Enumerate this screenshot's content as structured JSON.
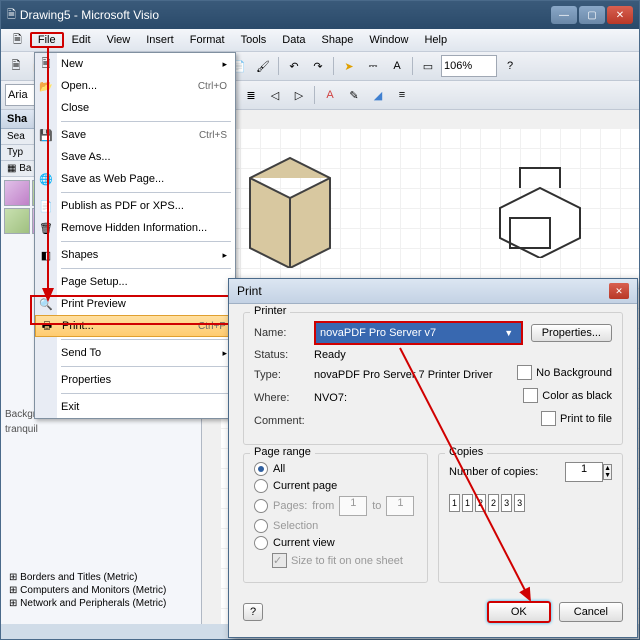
{
  "app": {
    "title": "Drawing5 - Microsoft Visio"
  },
  "menu": {
    "file": "File",
    "edit": "Edit",
    "view": "View",
    "insert": "Insert",
    "format": "Format",
    "tools": "Tools",
    "data": "Data",
    "shape": "Shape",
    "window": "Window",
    "help": "Help"
  },
  "toolbar": {
    "font": "Aria",
    "zoom": "106%"
  },
  "shapes": {
    "title": "Sha",
    "search_label": "Sea",
    "type_label": "Typ",
    "bg_label": "Ba",
    "bg_items": [
      "Background",
      "tranquil"
    ],
    "cats": [
      "Borders and Titles (Metric)",
      "Computers and Monitors (Metric)",
      "Network and Peripherals (Metric)"
    ]
  },
  "filemenu": {
    "new": "New",
    "open": "Open...",
    "open_sh": "Ctrl+O",
    "close": "Close",
    "save": "Save",
    "save_sh": "Ctrl+S",
    "saveas": "Save As...",
    "saveweb": "Save as Web Page...",
    "publish": "Publish as PDF or XPS...",
    "remove": "Remove Hidden Information...",
    "shapes": "Shapes",
    "pagesetup": "Page Setup...",
    "preview": "Print Preview",
    "print": "Print...",
    "print_sh": "Ctrl+P",
    "sendto": "Send To",
    "props": "Properties",
    "exit": "Exit"
  },
  "print": {
    "title": "Print",
    "printer_leg": "Printer",
    "name": "Name:",
    "name_val": "novaPDF Pro Server v7",
    "status": "Status:",
    "status_val": "Ready",
    "type": "Type:",
    "type_val": "novaPDF Pro Server 7 Printer Driver",
    "where": "Where:",
    "where_val": "NVO7:",
    "comment": "Comment:",
    "nobg": "No Background",
    "colorbw": "Color as black",
    "tofile": "Print to file",
    "props_btn": "Properties...",
    "range_leg": "Page range",
    "all": "All",
    "curpage": "Current page",
    "pages": "Pages:",
    "from": "from",
    "to": "to",
    "p1": "1",
    "p2": "1",
    "sel": "Selection",
    "curview": "Current view",
    "fit": "Size to fit on one sheet",
    "copies_leg": "Copies",
    "numcopies": "Number of copies:",
    "ncv": "1",
    "ok": "OK",
    "cancel": "Cancel"
  }
}
